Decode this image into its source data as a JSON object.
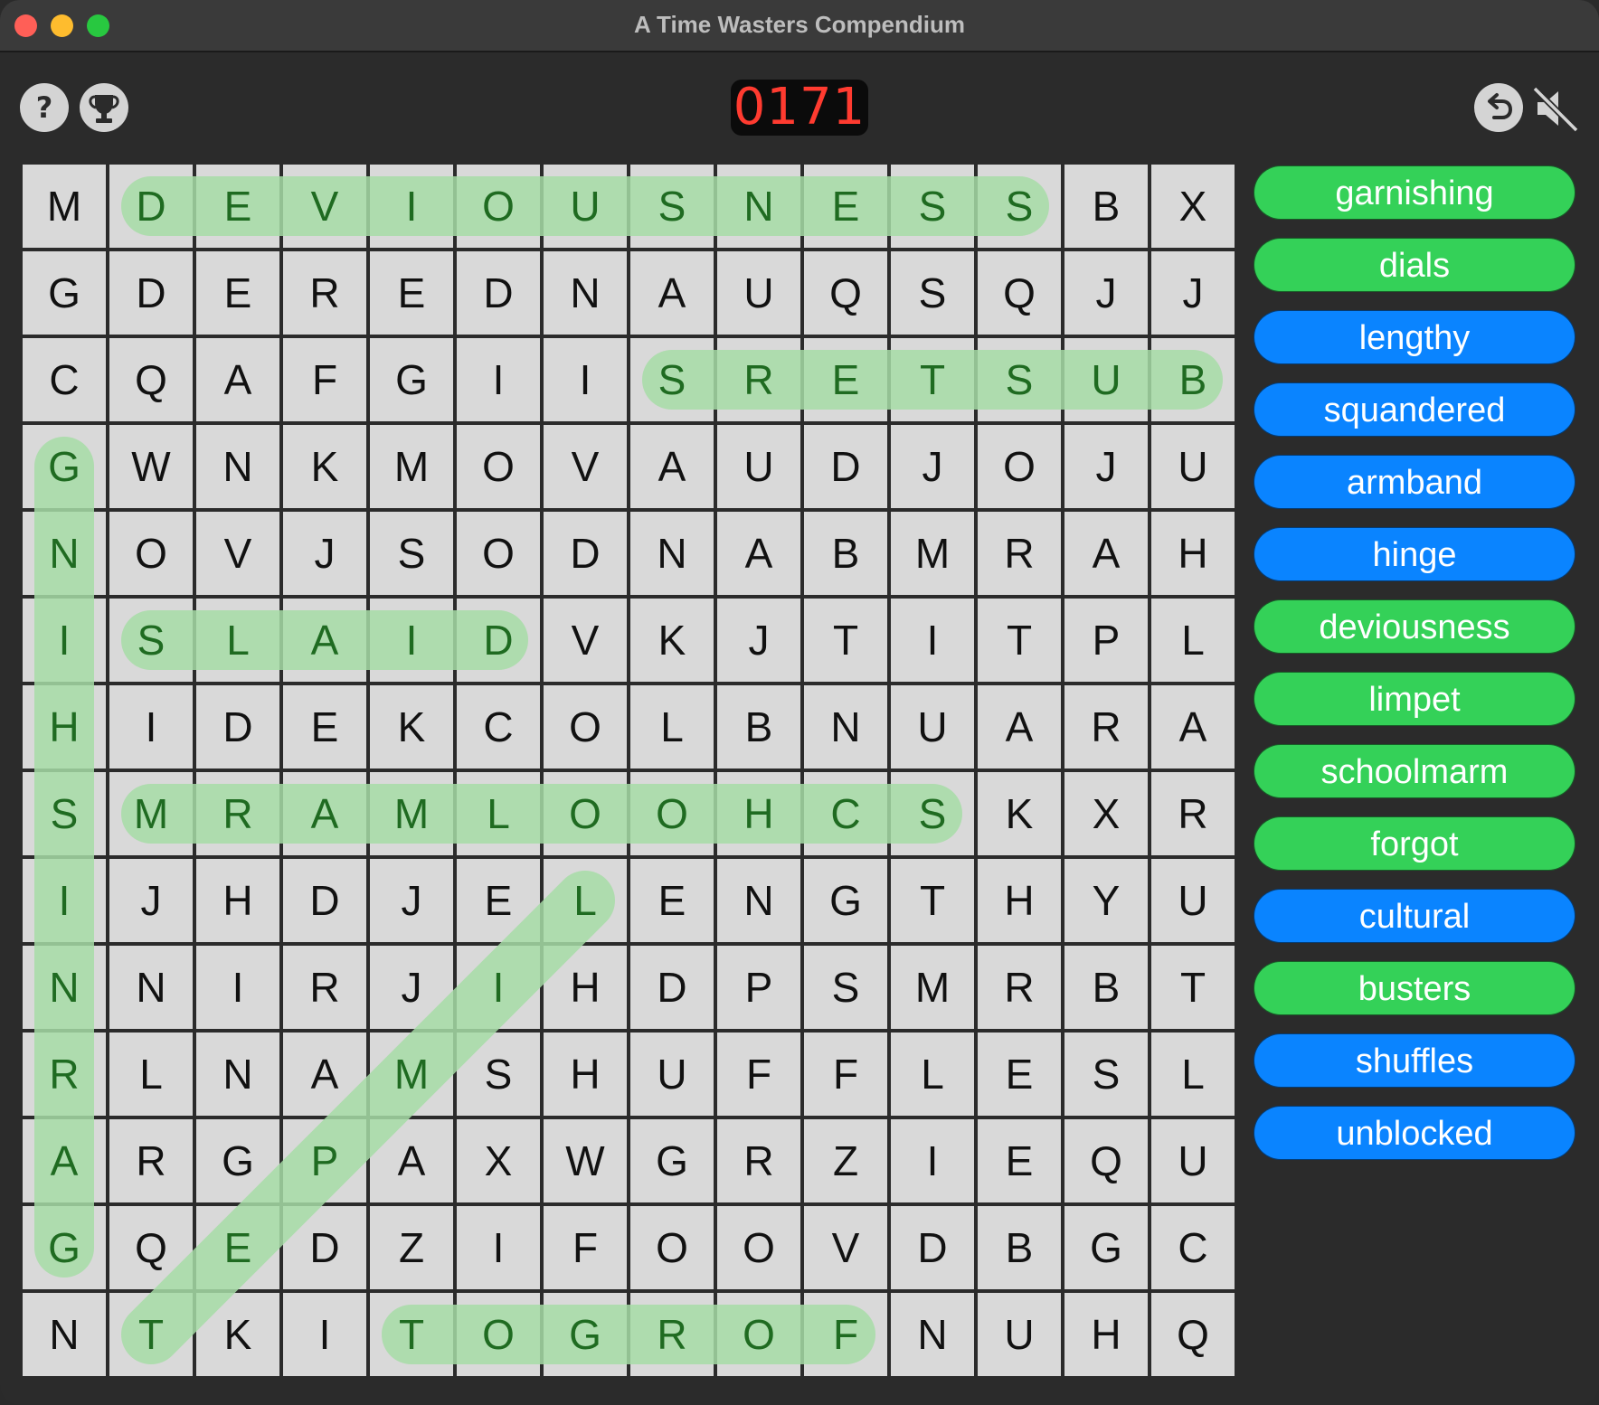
{
  "window": {
    "title": "A Time Wasters Compendium"
  },
  "toolbar": {
    "help_icon": "question-mark-icon",
    "trophy_icon": "trophy-icon",
    "score": "0171",
    "undo_icon": "undo-icon",
    "mute_icon": "speaker-muted-icon"
  },
  "colors": {
    "found_word": "#34d158",
    "remaining_word": "#0a84ff",
    "highlight": "#a6dca6",
    "score_text": "#ff3b30"
  },
  "grid": {
    "rows": [
      "MDEVIOUSNESSBX",
      "GDEREDNAUQSQJJ",
      "CQAFGIISRETSUB",
      "GWNKMOVAUDJOJU",
      "NOVJSODNABMRAH",
      "ISLAIDVKJTITPL",
      "HIDEKCOLBNUARA",
      "SMRAMLOOHCSKXR",
      "IJHDJELENGTHYU",
      "NNIRJIHDPSMRBT",
      "RLNAMSHUFFLESL",
      "ARGPAXWGRZIEQU",
      "GQEDZIFOOVDBGC",
      "NTKITOGROFNUHQ"
    ]
  },
  "found": [
    {
      "word": "deviousness",
      "from": [
        0,
        1
      ],
      "to": [
        0,
        11
      ]
    },
    {
      "word": "busters",
      "from": [
        2,
        13
      ],
      "to": [
        2,
        7
      ]
    },
    {
      "word": "garnishing",
      "from": [
        12,
        0
      ],
      "to": [
        3,
        0
      ]
    },
    {
      "word": "dials",
      "from": [
        5,
        5
      ],
      "to": [
        5,
        1
      ]
    },
    {
      "word": "schoolmarm",
      "from": [
        7,
        10
      ],
      "to": [
        7,
        1
      ]
    },
    {
      "word": "limpet",
      "from": [
        8,
        6
      ],
      "to": [
        13,
        1
      ]
    },
    {
      "word": "forgot",
      "from": [
        13,
        9
      ],
      "to": [
        13,
        4
      ]
    }
  ],
  "word_list": [
    {
      "label": "garnishing",
      "found": true
    },
    {
      "label": "dials",
      "found": true
    },
    {
      "label": "lengthy",
      "found": false
    },
    {
      "label": "squandered",
      "found": false
    },
    {
      "label": "armband",
      "found": false
    },
    {
      "label": "hinge",
      "found": false
    },
    {
      "label": "deviousness",
      "found": true
    },
    {
      "label": "limpet",
      "found": true
    },
    {
      "label": "schoolmarm",
      "found": true
    },
    {
      "label": "forgot",
      "found": true
    },
    {
      "label": "cultural",
      "found": false
    },
    {
      "label": "busters",
      "found": true
    },
    {
      "label": "shuffles",
      "found": false
    },
    {
      "label": "unblocked",
      "found": false
    }
  ]
}
